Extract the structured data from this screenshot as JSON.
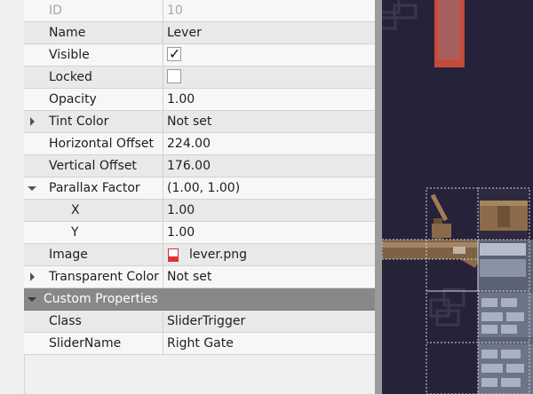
{
  "properties": [
    {
      "name": "ID",
      "value": "10",
      "disabled": true
    },
    {
      "name": "Name",
      "value": "Lever"
    },
    {
      "name": "Visible",
      "checkbox": true,
      "checked": true
    },
    {
      "name": "Locked",
      "checkbox": true,
      "checked": false
    },
    {
      "name": "Opacity",
      "value": "1.00"
    },
    {
      "name": "Tint Color",
      "value": "Not set",
      "expander": "collapsed"
    },
    {
      "name": "Horizontal Offset",
      "value": "224.00"
    },
    {
      "name": "Vertical Offset",
      "value": "176.00"
    },
    {
      "name": "Parallax Factor",
      "value": "(1.00, 1.00)",
      "expander": "expanded"
    },
    {
      "name": "X",
      "value": "1.00",
      "indent": true
    },
    {
      "name": "Y",
      "value": "1.00",
      "indent": true
    },
    {
      "name": "Image",
      "value": "lever.png",
      "file_icon": "png-file-icon"
    },
    {
      "name": "Transparent Color",
      "value": "Not set",
      "expander": "collapsed"
    }
  ],
  "custom_group": {
    "label": "Custom Properties",
    "expander": "expanded"
  },
  "custom_properties": [
    {
      "name": "Class",
      "value": "SliderTrigger"
    },
    {
      "name": "SliderName",
      "value": "Right Gate"
    }
  ],
  "colors": {
    "canvas_background": "#26223a",
    "group_header": "#888888",
    "selection_dashes": "#d9d9d9"
  }
}
